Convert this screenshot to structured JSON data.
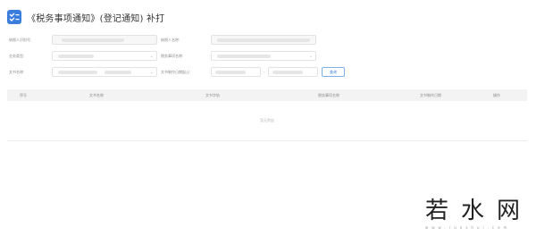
{
  "header": {
    "title": "《税务事项通知》(登记通知) 补打",
    "icon": "checklist-icon"
  },
  "form": {
    "row1": {
      "taxpayer_id_label": "纳税人识别号:",
      "taxpayer_name_label": "纳税人名称:"
    },
    "row2": {
      "business_type_label": "业务类型:",
      "matter_name_label": "税务事项名称:"
    },
    "row3": {
      "doc_no_label": "文书名称:",
      "doc_date_label": "文书制作日期起止:",
      "date_sep": "-",
      "query_label": "查询"
    }
  },
  "table": {
    "columns": [
      "序号",
      "文书名称",
      "文书字轨",
      "税务事项名称",
      "文书制作日期",
      "操作"
    ],
    "empty_text": "暂无数据"
  },
  "watermark": {
    "text": "若水网",
    "sub": "www.ruoshui.com"
  },
  "colors": {
    "accent": "#3b7ddd",
    "header_bg": "#f3f3f3"
  }
}
